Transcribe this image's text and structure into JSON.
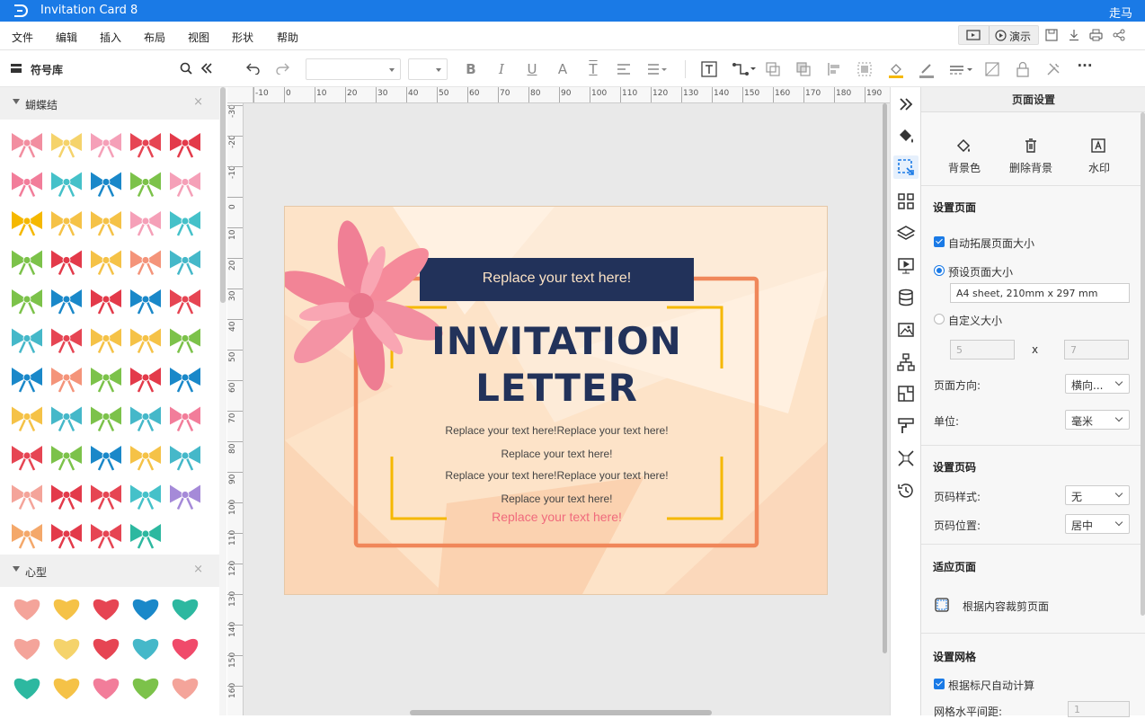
{
  "app": {
    "title": "Invitation Card 8",
    "user": "走马"
  },
  "menu": [
    "文件",
    "编辑",
    "插入",
    "布局",
    "视图",
    "形状",
    "帮助"
  ],
  "topright": {
    "present_label": "演示"
  },
  "library": {
    "title": "符号库",
    "categories": [
      {
        "name": "蝴蝶结"
      },
      {
        "name": "心型"
      }
    ]
  },
  "toolbar": {
    "font_value": "",
    "size_value": ""
  },
  "ruler": {
    "h_ticks": [
      "-10",
      "0",
      "10",
      "20",
      "30",
      "40",
      "50",
      "60",
      "70",
      "80",
      "90",
      "100",
      "110",
      "120",
      "130",
      "140",
      "150",
      "160",
      "170",
      "180",
      "190"
    ],
    "v_ticks": [
      "-30",
      "-20",
      "-10",
      "0",
      "10",
      "20",
      "30",
      "40",
      "50",
      "60",
      "70",
      "80",
      "90",
      "100",
      "110",
      "120",
      "130",
      "140",
      "150",
      "160"
    ]
  },
  "card": {
    "banner": "Replace your text here!",
    "heading1": "INVITATION",
    "heading2": "LETTER",
    "line1": "Replace your text here!Replace your text here!",
    "line2": "Replace your text here!",
    "line3": "Replace your text here!Replace your text here!",
    "line4": "Replace your text here!",
    "line5": "Replace your text here!"
  },
  "rpanel": {
    "title": "页面设置",
    "actions": {
      "bg_color": "背景色",
      "delete_bg": "删除背景",
      "watermark": "水印"
    },
    "page_section": "设置页面",
    "auto_extend": "自动拓展页面大小",
    "preset_size": "预设页面大小",
    "preset_value": "A4 sheet, 210mm x 297 mm",
    "custom_size": "自定义大小",
    "custom_w": "5",
    "custom_x": "x",
    "custom_h": "7",
    "orientation_label": "页面方向:",
    "orientation_value": "横向...",
    "unit_label": "单位:",
    "unit_value": "毫米",
    "pagenum_section": "设置页码",
    "pagenum_style_label": "页码样式:",
    "pagenum_style_value": "无",
    "pagenum_pos_label": "页码位置:",
    "pagenum_pos_value": "居中",
    "fit_section": "适应页面",
    "fit_crop": "根据内容裁剪页面",
    "grid_section": "设置网格",
    "grid_auto": "根据标尺自动计算",
    "grid_h_label": "网格水平间距:",
    "grid_h_value": "1"
  },
  "colors": {
    "accent": "#1a7ae6",
    "card_bg": "#fde3c8",
    "navy": "#22325a",
    "frame": "#f0875a",
    "gold": "#f5b800",
    "pink": "#f58a9a"
  }
}
